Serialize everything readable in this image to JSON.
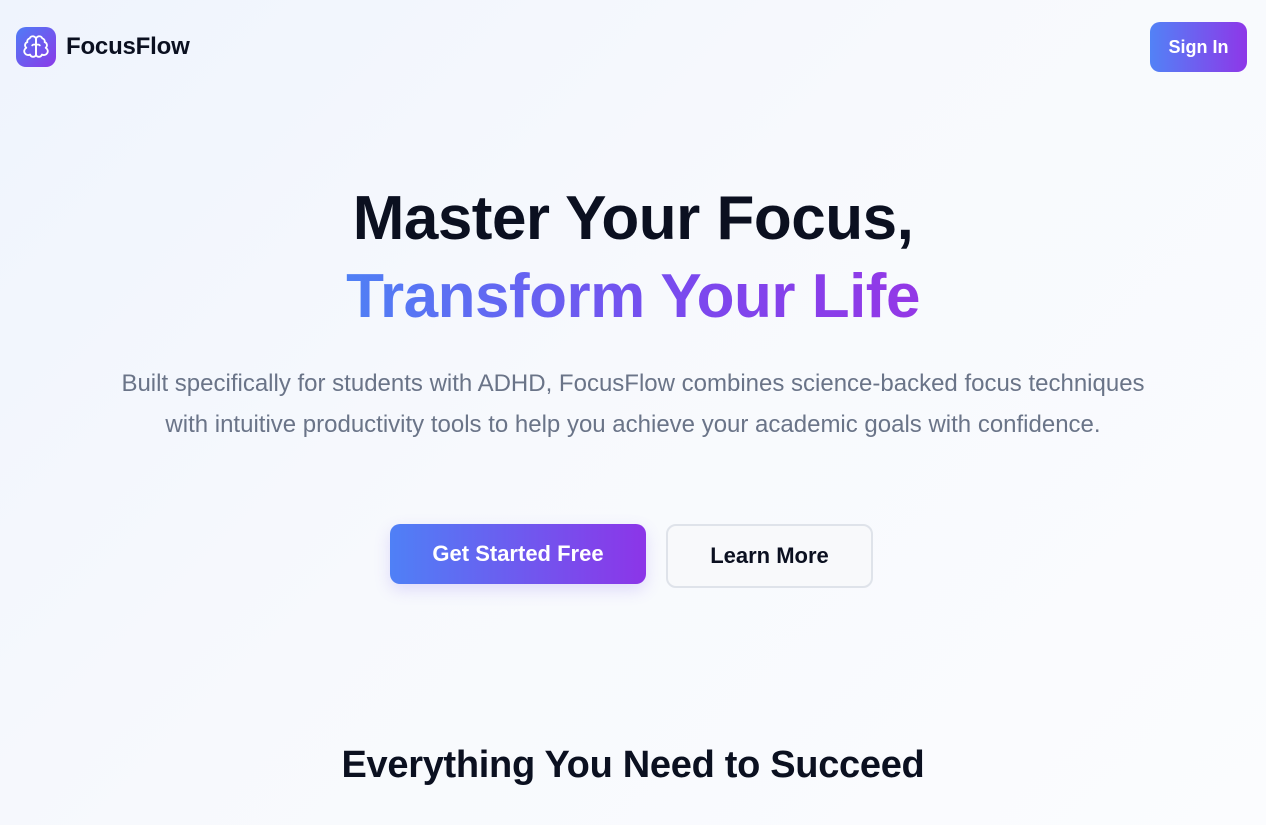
{
  "header": {
    "logo_icon": "brain-icon",
    "brand_name": "FocusFlow",
    "signin_label": "Sign In"
  },
  "hero": {
    "title_line1": "Master Your Focus,",
    "title_line2": "Transform Your Life",
    "description": "Built specifically for students with ADHD, FocusFlow combines science-backed focus techniques with intuitive productivity tools to help you achieve your academic goals with confidence.",
    "primary_cta": "Get Started Free",
    "secondary_cta": "Learn More"
  },
  "features": {
    "title": "Everything You Need to Succeed"
  },
  "colors": {
    "gradient_start": "#4f80f6",
    "gradient_end": "#8c35e8",
    "text_dark": "#0b1020",
    "text_muted": "#6a7488"
  }
}
